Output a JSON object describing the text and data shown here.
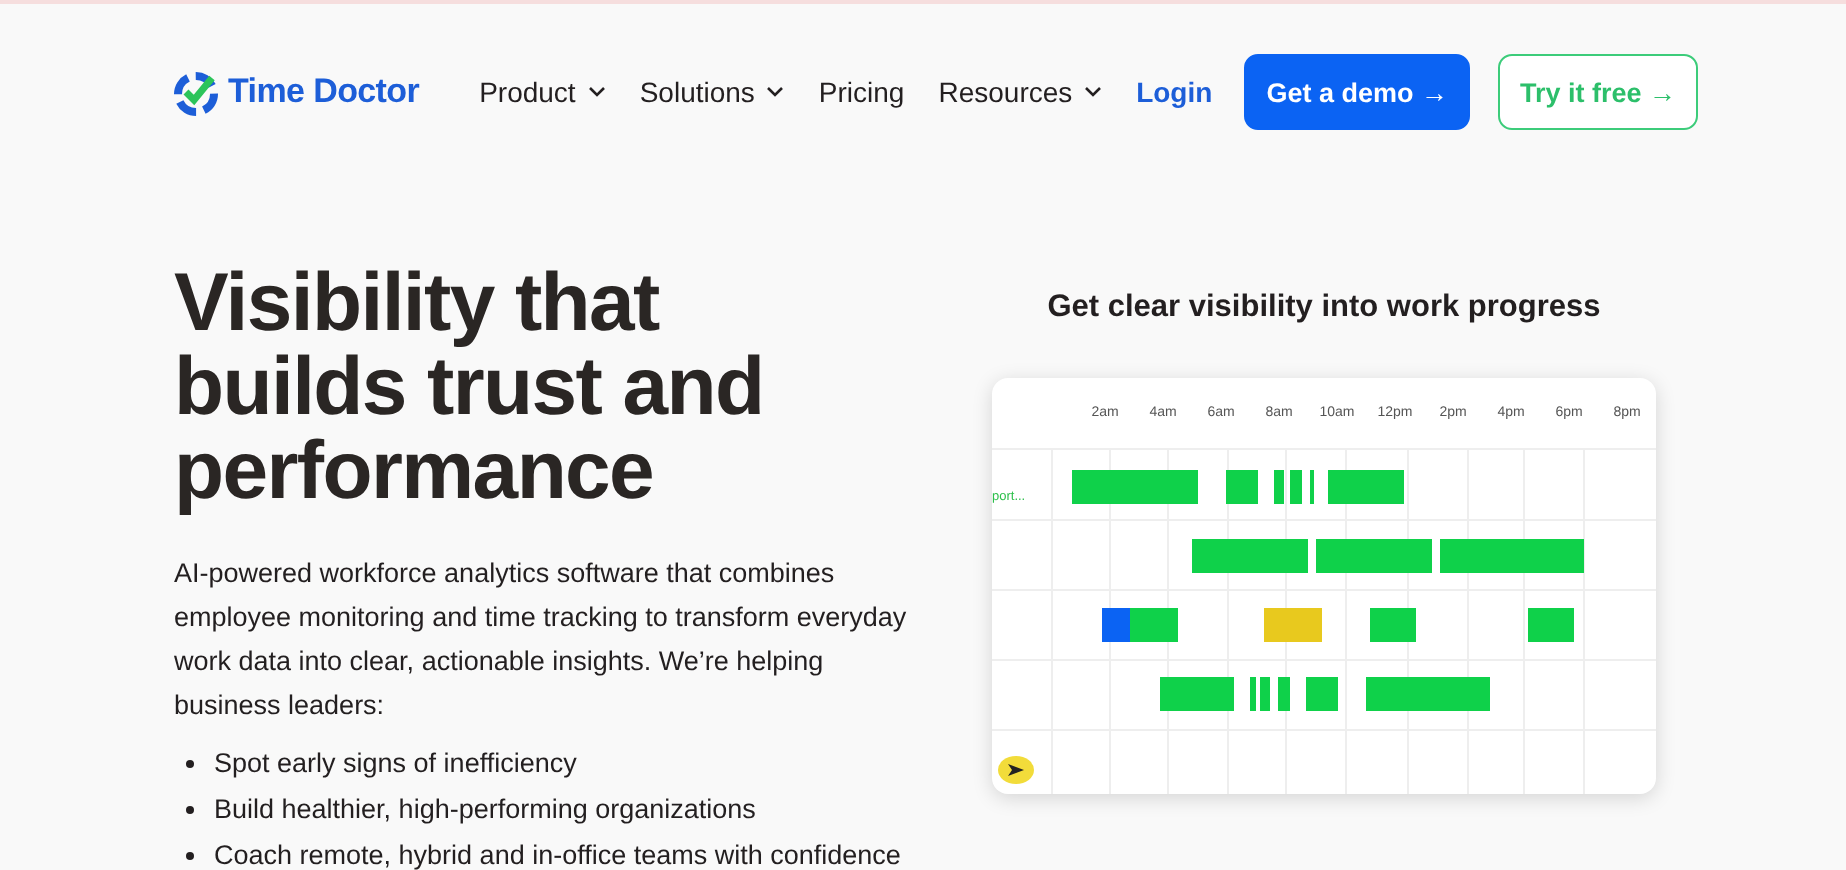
{
  "header": {
    "brand": "Time Doctor",
    "nav": [
      {
        "label": "Product",
        "dropdown": true
      },
      {
        "label": "Solutions",
        "dropdown": true
      },
      {
        "label": "Pricing",
        "dropdown": false
      },
      {
        "label": "Resources",
        "dropdown": true
      }
    ],
    "login": "Login",
    "demo_button": "Get a demo →",
    "trial_button": "Try it free →"
  },
  "hero": {
    "heading": "Visibility that builds trust and performance",
    "intro": "AI-powered workforce analytics software that combines employee monitoring and time tracking to transform everyday work data into clear, actionable insights. We’re helping business leaders:",
    "bullets": [
      "Spot early signs of inefficiency",
      "Build healthier, high-performing organizations",
      "Coach remote, hybrid and in-office teams with confidence"
    ]
  },
  "preview": {
    "title": "Get clear visibility into work progress",
    "times": [
      "2am",
      "4am",
      "6am",
      "8am",
      "10am",
      "12pm",
      "2pm",
      "4pm",
      "6pm",
      "8pm"
    ],
    "row_label": "port..."
  }
}
